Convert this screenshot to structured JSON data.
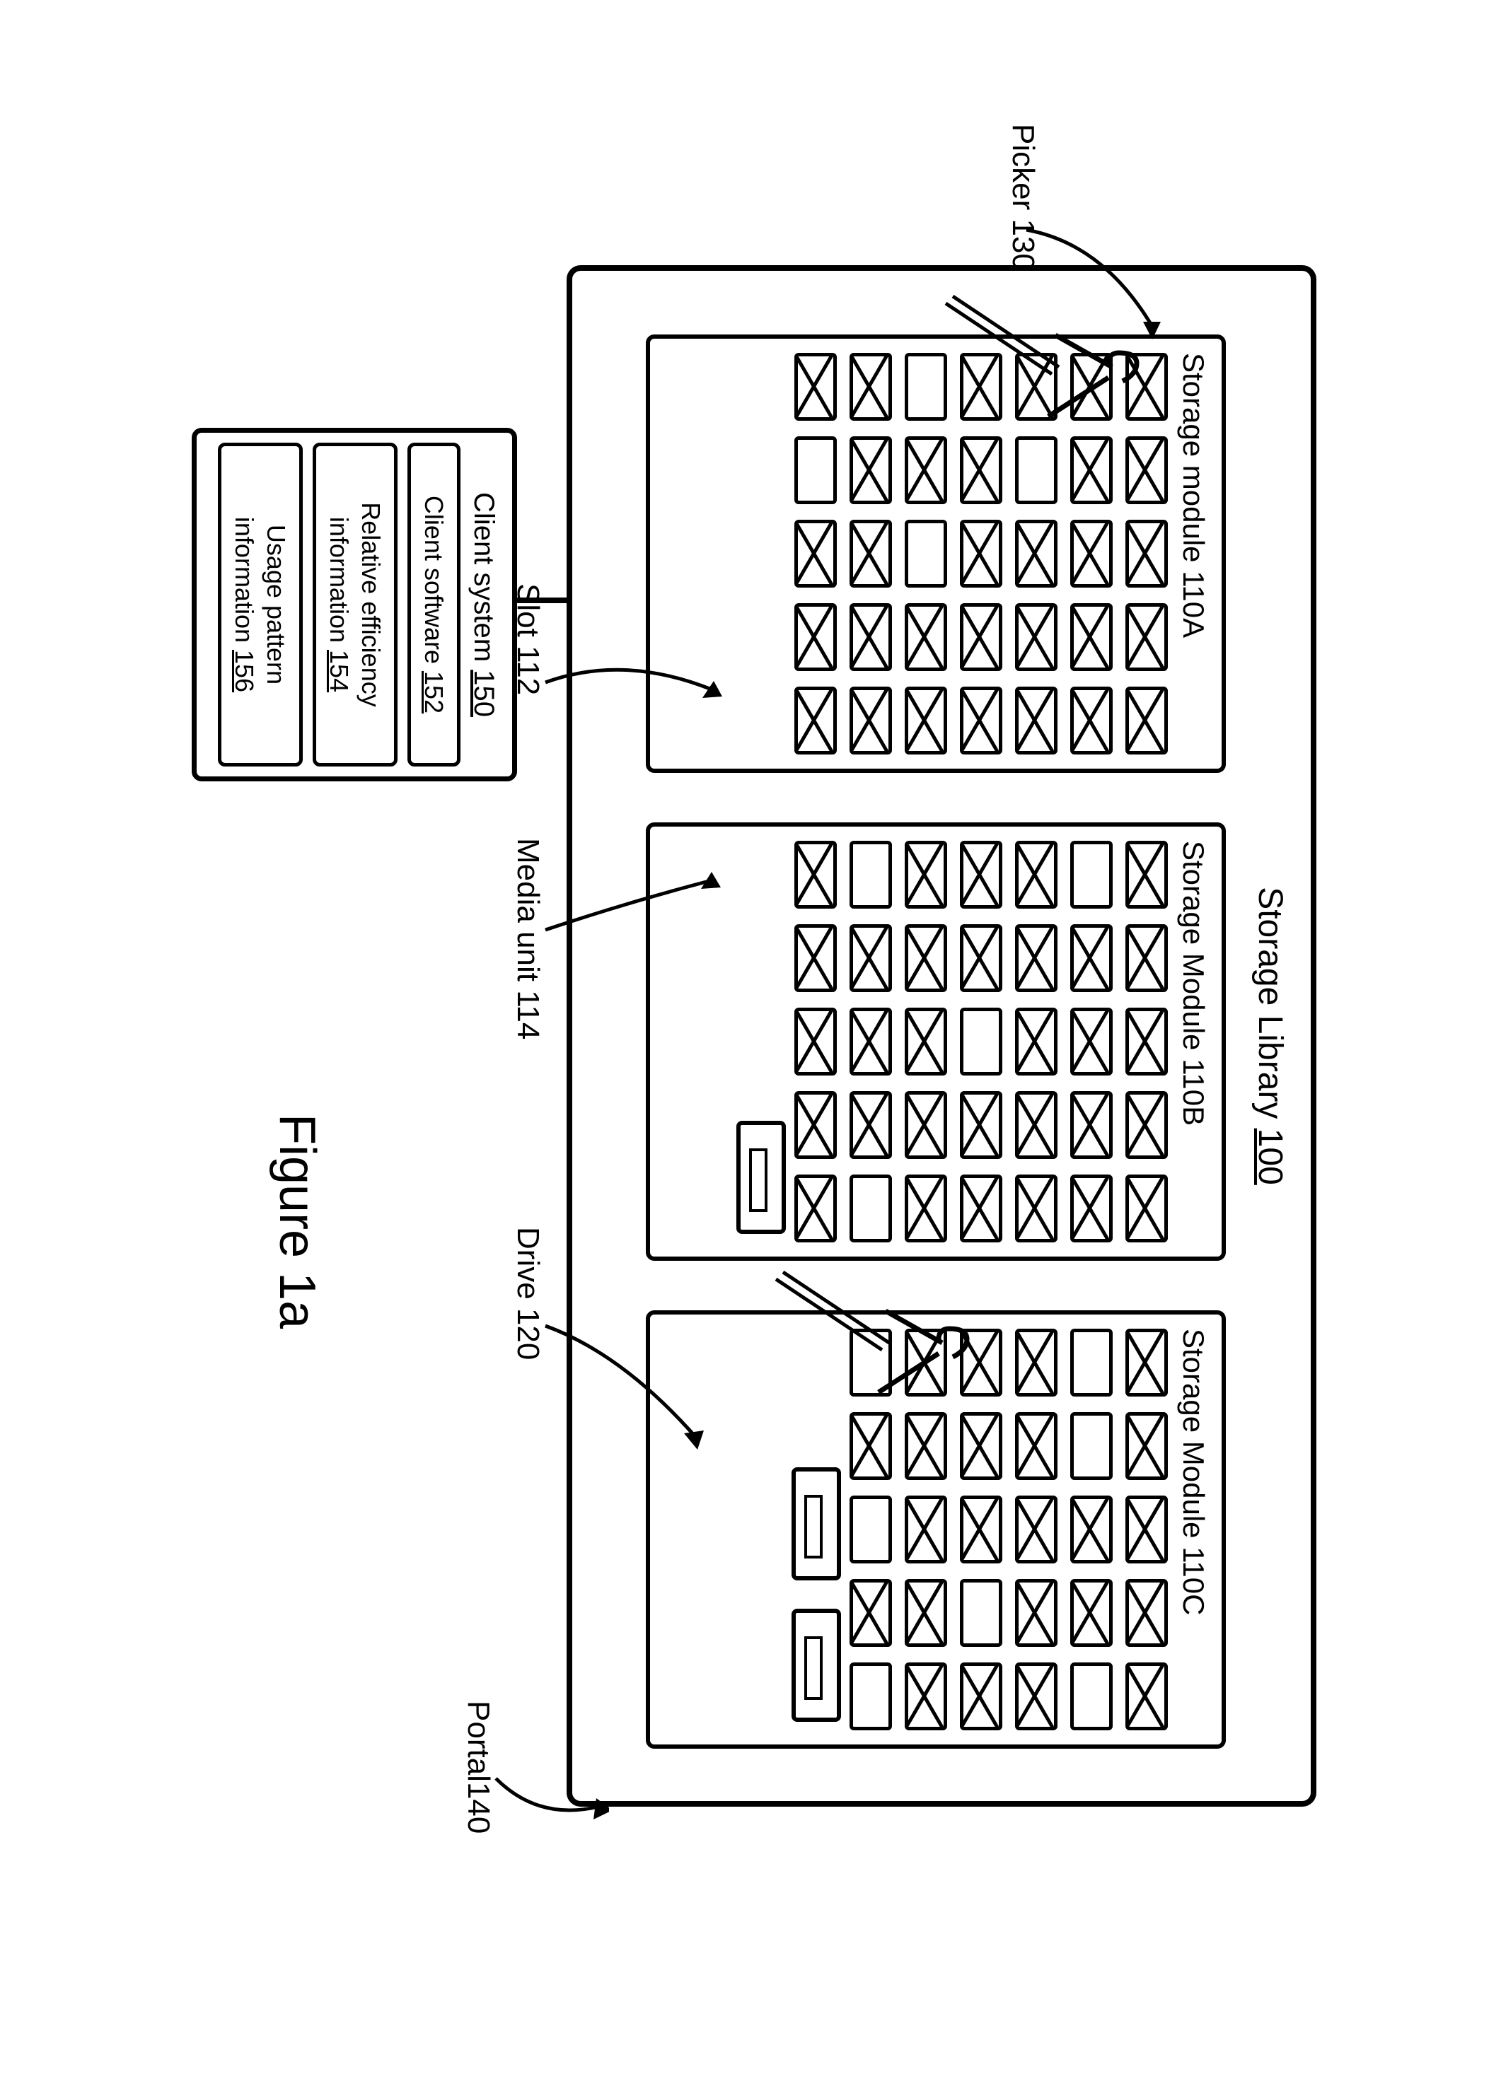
{
  "library": {
    "title_prefix": "Storage Library ",
    "title_num": "100"
  },
  "modules": {
    "a": "Storage module 110A",
    "b": "Storage Module 110B",
    "c": "Storage Module 110C"
  },
  "callouts": {
    "picker": "Picker 130",
    "slot": "Slot 112",
    "media_unit": "Media unit 114",
    "drive": "Drive 120",
    "portal": "Portal140"
  },
  "client": {
    "title_prefix": "Client system ",
    "title_num": "150",
    "software_prefix": "Client software ",
    "software_num": "152",
    "eff_line1": "Relative efficiency",
    "eff_line2_prefix": "information ",
    "eff_num": "154",
    "usage_line1": "Usage pattern",
    "usage_line2_prefix": "information ",
    "usage_num": "156"
  },
  "figure_caption": "Figure 1a",
  "slot_states": {
    "module_a": [
      1,
      1,
      1,
      1,
      1,
      1,
      1,
      1,
      1,
      1,
      1,
      0,
      1,
      1,
      1,
      1,
      1,
      1,
      1,
      1,
      0,
      1,
      0,
      1,
      1,
      1,
      1,
      1,
      1,
      1,
      1,
      0,
      1,
      1,
      1
    ],
    "module_b": [
      1,
      1,
      1,
      1,
      1,
      0,
      1,
      1,
      1,
      1,
      1,
      1,
      1,
      1,
      1,
      1,
      1,
      0,
      1,
      1,
      1,
      1,
      1,
      1,
      1,
      0,
      1,
      1,
      1,
      0,
      1,
      1,
      1,
      1,
      1
    ],
    "module_c": [
      1,
      1,
      1,
      1,
      1,
      0,
      0,
      1,
      1,
      0,
      1,
      1,
      1,
      1,
      1,
      1,
      1,
      1,
      0,
      1,
      1,
      1,
      1,
      1,
      1,
      0,
      1,
      0,
      1,
      0
    ]
  }
}
